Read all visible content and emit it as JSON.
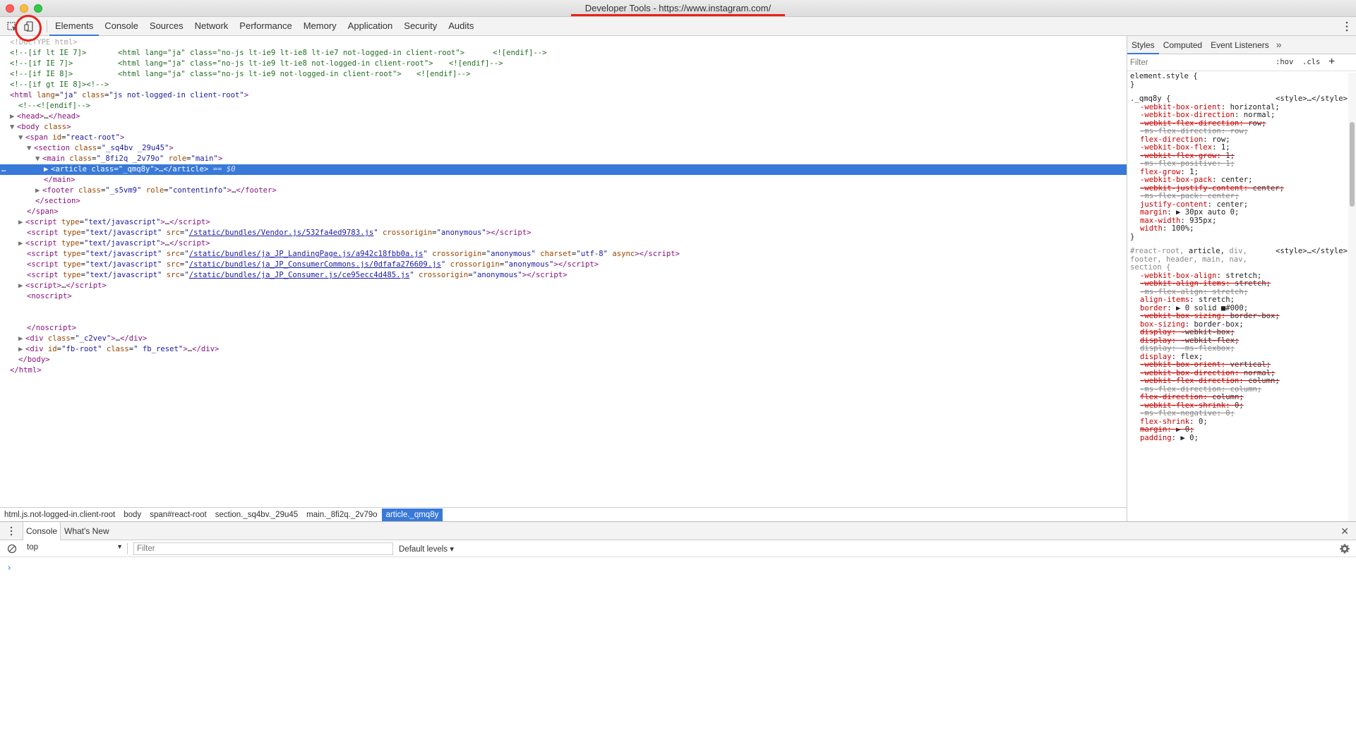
{
  "window": {
    "title": "Developer Tools - https://www.instagram.com/"
  },
  "toolbar": {
    "inspect_icon": "inspect-element-icon",
    "device_icon": "device-toolbar-icon",
    "tabs": [
      "Elements",
      "Console",
      "Sources",
      "Network",
      "Performance",
      "Memory",
      "Application",
      "Security",
      "Audits"
    ],
    "active_tab": "Elements"
  },
  "dom": {
    "doctype": "<!DOCTYPE html>",
    "cond1_open": "<!--[if lt IE 7]>",
    "cond1_html": "<html lang=\"ja\" class=\"no-js lt-ie9 lt-ie8 lt-ie7 not-logged-in client-root\">",
    "cond1_close": "<![endif]-->",
    "cond2_open": "<!--[if IE 7]>",
    "cond2_html": "<html lang=\"ja\" class=\"no-js lt-ie9 lt-ie8 not-logged-in client-root\">",
    "cond2_close": "<![endif]-->",
    "cond3_open": "<!--[if IE 8]>",
    "cond3_html": "<html lang=\"ja\" class=\"no-js lt-ie9 not-logged-in client-root\">",
    "cond3_close": "<![endif]-->",
    "cond4": "<!--[if gt IE 8]><!-->",
    "html_tag": "html",
    "html_lang_attr": "lang",
    "html_lang_val": "\"ja\"",
    "html_class_attr": "class",
    "html_class_val": "\"js not-logged-in client-root\"",
    "endif": "<!--<![endif]-->",
    "head": "head",
    "body": "body",
    "body_class": "class",
    "span_tag": "span",
    "span_id": "id",
    "span_id_val": "\"react-root\"",
    "section_class_val": "\"_sq4bv _29u45\"",
    "main_class_val": "\"_8fi2q _2v79o\"",
    "main_role_val": "\"main\"",
    "article_class_val": "\"_qmq8y\"",
    "selected_marker": "== $0",
    "footer_class_val": "\"_s5vm9\"",
    "footer_role_val": "\"contentinfo\"",
    "script_type_val": "\"text/javascript\"",
    "src1": "/static/bundles/Vendor.js/532fa4ed9783.js",
    "src2": "/static/bundles/ja_JP_LandingPage.js/a942c18fbb0a.js",
    "src3": "/static/bundles/ja_JP_ConsumerCommons.js/0dfafa276609.js",
    "src4": "/static/bundles/ja_JP_Consumer.js/ce95ecc4d485.js",
    "crossorigin_val": "\"anonymous\"",
    "charset_val": "\"utf-8\"",
    "div1_class_val": "\"_c2vev\"",
    "fbroot_id_val": "\"fb-root\"",
    "fbroot_class_val": "\" fb_reset\""
  },
  "breadcrumb": [
    "html.js.not-logged-in.client-root",
    "body",
    "span#react-root",
    "section._sq4bv._29u45",
    "main._8fi2q._2v79o",
    "article._qmq8y"
  ],
  "sidebar": {
    "tabs": [
      "Styles",
      "Computed",
      "Event Listeners"
    ],
    "more": "»",
    "filter_placeholder": "Filter",
    "hov": ":hov",
    "cls": ".cls",
    "plus": "+",
    "element_style": "element.style {",
    "close_brace": "}",
    "rule1_selector": "._qmq8y {",
    "rule1_source": "<style>…</style>",
    "rule1_props": [
      {
        "n": "-webkit-box-orient",
        "v": "horizontal;",
        "s": "normal"
      },
      {
        "n": "-webkit-box-direction",
        "v": "normal;",
        "s": "normal"
      },
      {
        "n": "-webkit-flex-direction",
        "v": "row;",
        "s": "strike"
      },
      {
        "n": "-ms-flex-direction",
        "v": "row;",
        "s": "vp"
      },
      {
        "n": "flex-direction",
        "v": "row;",
        "s": "normal"
      },
      {
        "n": "-webkit-box-flex",
        "v": "1;",
        "s": "normal"
      },
      {
        "n": "-webkit-flex-grow",
        "v": "1;",
        "s": "strike"
      },
      {
        "n": "-ms-flex-positive",
        "v": "1;",
        "s": "vp"
      },
      {
        "n": "flex-grow",
        "v": "1;",
        "s": "normal"
      },
      {
        "n": "-webkit-box-pack",
        "v": "center;",
        "s": "normal"
      },
      {
        "n": "-webkit-justify-content",
        "v": "center;",
        "s": "strike"
      },
      {
        "n": "-ms-flex-pack",
        "v": "center;",
        "s": "vp"
      },
      {
        "n": "justify-content",
        "v": "center;",
        "s": "normal"
      },
      {
        "n": "margin",
        "v": "▶ 30px auto 0;",
        "s": "normal"
      },
      {
        "n": "max-width",
        "v": "935px;",
        "s": "normal"
      },
      {
        "n": "width",
        "v": "100%;",
        "s": "normal"
      }
    ],
    "rule2_selector_l1a": "#react-root, ",
    "rule2_selector_l1b": "article, ",
    "rule2_selector_l1c": "div,",
    "rule2_selector_l2": "footer, header, main, nav,",
    "rule2_selector_l3": "section {",
    "rule2_source": "<style>…</style>",
    "rule2_props": [
      {
        "n": "-webkit-box-align",
        "v": "stretch;",
        "s": "normal"
      },
      {
        "n": "-webkit-align-items",
        "v": "stretch;",
        "s": "strike"
      },
      {
        "n": "-ms-flex-align",
        "v": "stretch;",
        "s": "vp"
      },
      {
        "n": "align-items",
        "v": "stretch;",
        "s": "normal"
      },
      {
        "n": "border",
        "v": "▶ 0 solid ■#000;",
        "s": "normal"
      },
      {
        "n": "-webkit-box-sizing",
        "v": "border-box;",
        "s": "strike"
      },
      {
        "n": "box-sizing",
        "v": "border-box;",
        "s": "normal"
      },
      {
        "n": "display",
        "v": "-webkit-box;",
        "s": "strike"
      },
      {
        "n": "display",
        "v": "-webkit-flex;",
        "s": "strike"
      },
      {
        "n": "display",
        "v": "-ms-flexbox;",
        "s": "vp"
      },
      {
        "n": "display",
        "v": "flex;",
        "s": "normal"
      },
      {
        "n": "-webkit-box-orient",
        "v": "vertical;",
        "s": "strike"
      },
      {
        "n": "-webkit-box-direction",
        "v": "normal;",
        "s": "strike"
      },
      {
        "n": "-webkit-flex-direction",
        "v": "column;",
        "s": "strike"
      },
      {
        "n": "-ms-flex-direction",
        "v": "column;",
        "s": "vp"
      },
      {
        "n": "flex-direction",
        "v": "column;",
        "s": "strike"
      },
      {
        "n": "-webkit-flex-shrink",
        "v": "0;",
        "s": "strike"
      },
      {
        "n": "-ms-flex-negative",
        "v": "0;",
        "s": "vp"
      },
      {
        "n": "flex-shrink",
        "v": "0;",
        "s": "normal"
      },
      {
        "n": "margin",
        "v": "▶ 0;",
        "s": "strike"
      },
      {
        "n": "padding",
        "v": "▶ 0;",
        "s": "normal"
      }
    ]
  },
  "drawer": {
    "tabs": [
      "Console",
      "What's New"
    ],
    "close": "✕",
    "context": "top",
    "filter_placeholder": "Filter",
    "levels": "Default levels ▾",
    "prompt": "›"
  },
  "colors": {
    "accent": "#3879d9",
    "annotation": "#e8201b"
  }
}
